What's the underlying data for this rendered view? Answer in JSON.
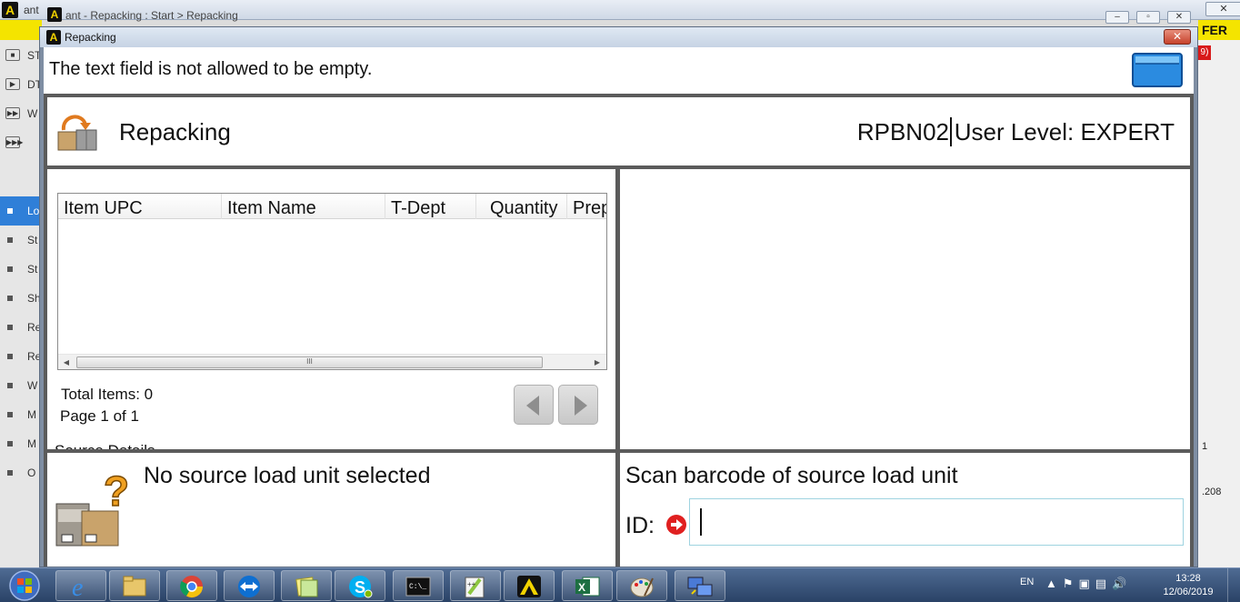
{
  "background_app": {
    "title_fragment": "ant",
    "inner_title": "ant - Repacking : Start > Repacking",
    "brand_fragment": "FER",
    "right_badge": "9)",
    "right_value": ".208",
    "right_count": "1",
    "sidebar_controls": [
      {
        "glyph": "■",
        "label": "ST"
      },
      {
        "glyph": "▶",
        "label": "DT"
      },
      {
        "glyph": "▶▶",
        "label": "W"
      },
      {
        "glyph": "▶▶▶",
        "label": ""
      }
    ],
    "sidebar_items": [
      "Lo",
      "St",
      "St",
      "Sh",
      "Re",
      "Re",
      "W",
      "M",
      "M",
      "O"
    ]
  },
  "dialog": {
    "title": "Repacking",
    "close_label": "✕",
    "message": "The text field is not allowed to be empty.",
    "header": {
      "title": "Repacking",
      "station": "RPBN02",
      "user_level": "User Level: EXPERT"
    },
    "grid": {
      "columns": [
        "Item UPC",
        "Item Name",
        "T-Dept",
        "Quantity",
        "Prep"
      ],
      "rows": [],
      "scroll_thumb": "III"
    },
    "total_items": "Total Items: 0",
    "page_info": "Page 1 of 1",
    "clipped_label": "Source Details",
    "source_status": "No source load unit selected",
    "scan_prompt": "Scan barcode of source load unit",
    "id_label": "ID:",
    "id_value": ""
  },
  "taskbar": {
    "apps": [
      "internet-explorer",
      "file-explorer",
      "chrome",
      "teamviewer",
      "sticky-notes",
      "skype",
      "command-prompt",
      "notepad-plus-plus",
      "ant-app",
      "excel",
      "paint",
      "remote-desktop"
    ],
    "language": "EN",
    "time": "13:28",
    "date": "12/06/2019"
  },
  "colors": {
    "panel_gray": "#5b5b5b",
    "accent_blue": "#2f7fd8",
    "brand_yellow": "#f4e400",
    "close_red": "#c6422c",
    "arrow_red": "#e02020"
  }
}
